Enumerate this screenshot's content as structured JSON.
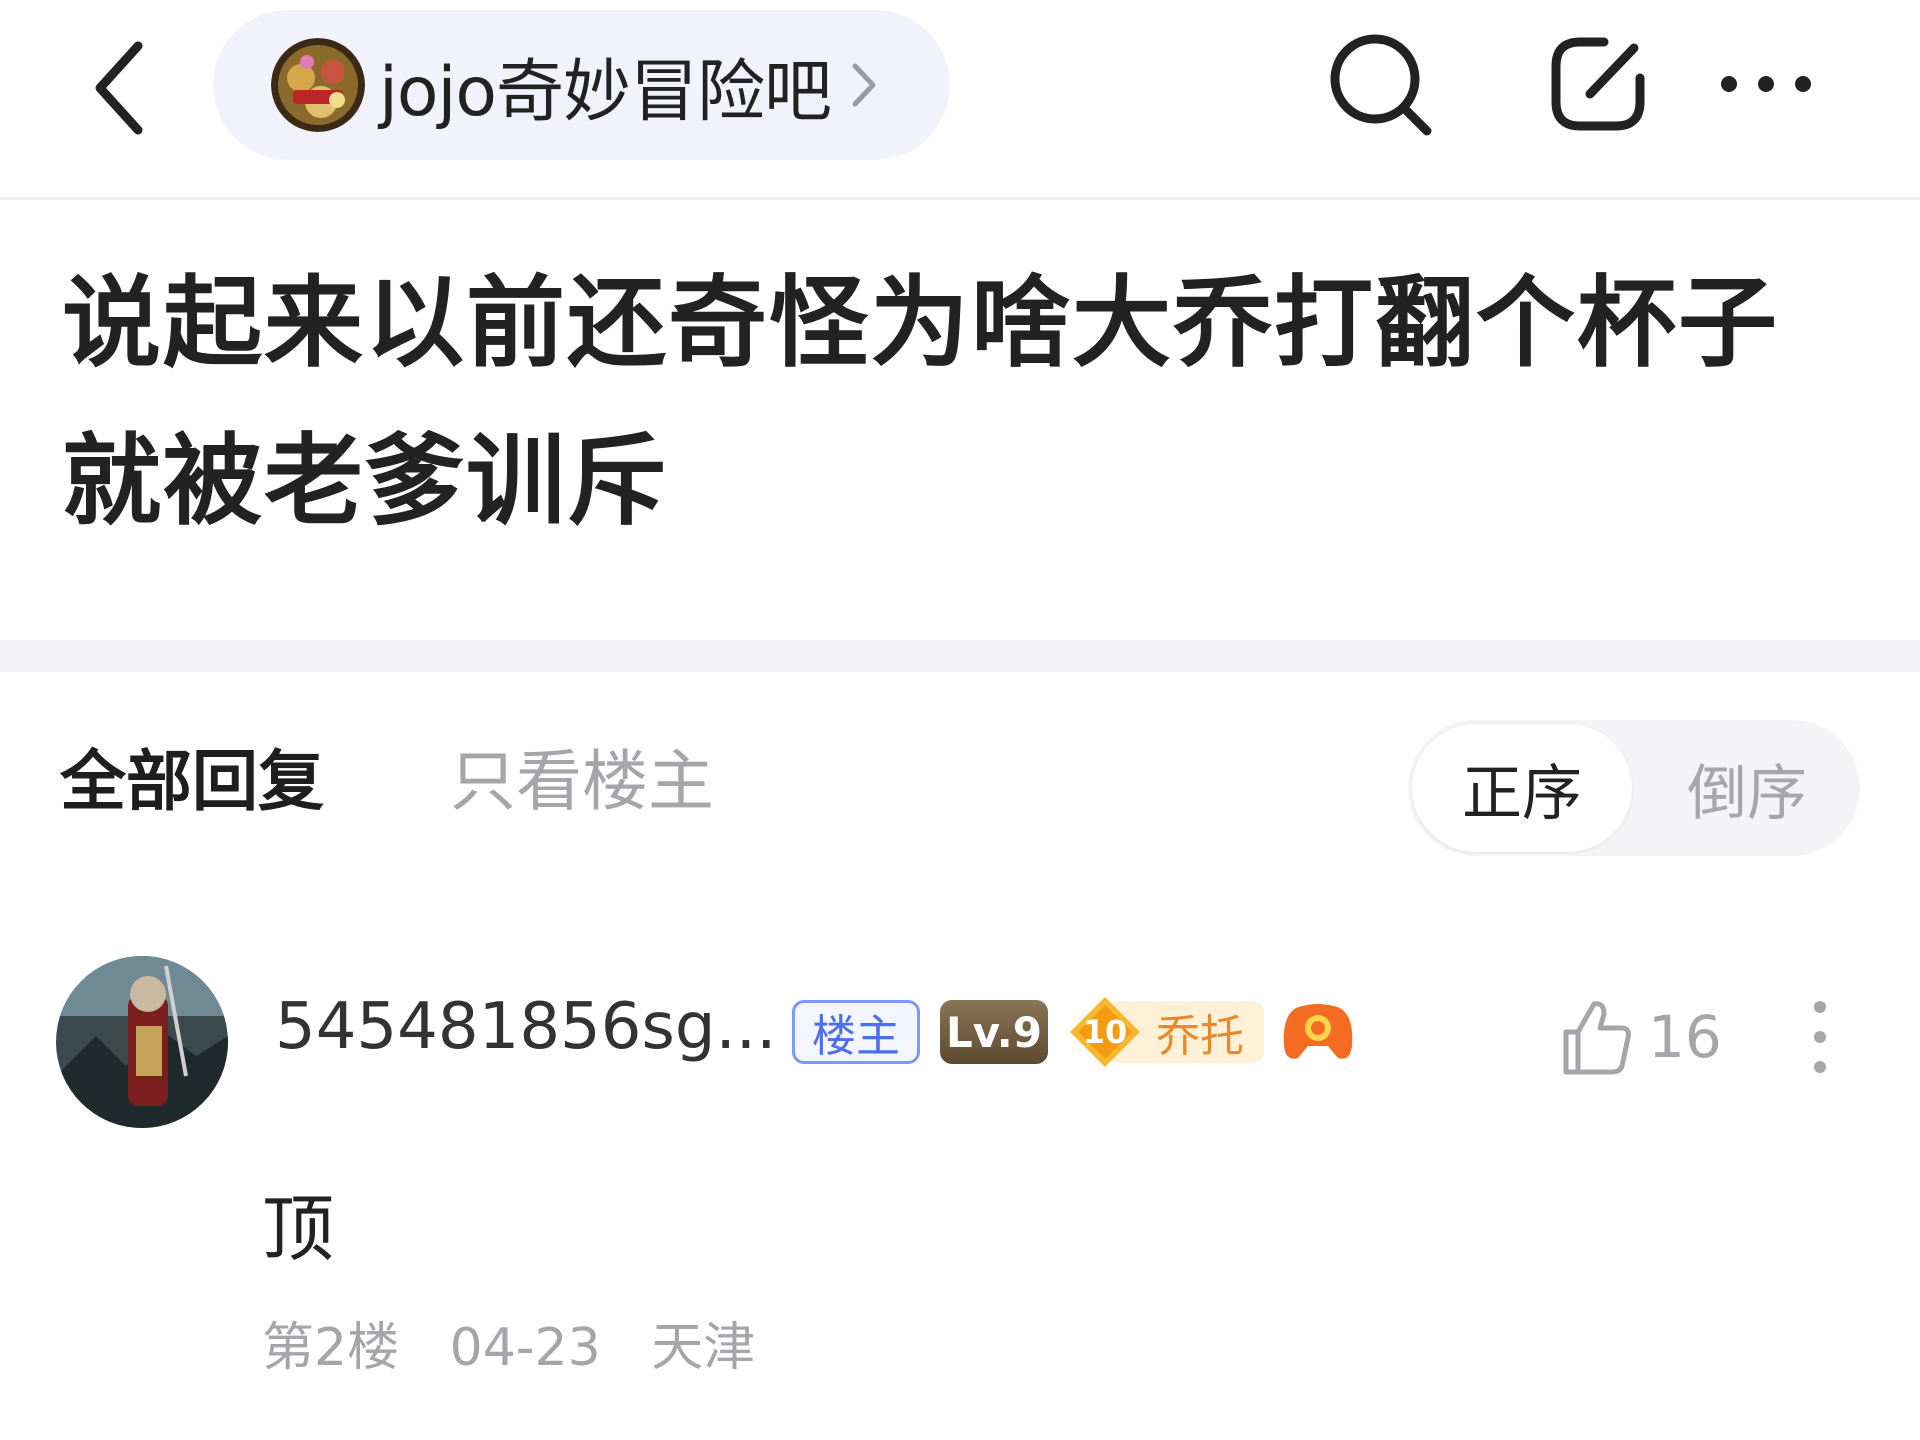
{
  "header": {
    "forum_name": "jojo奇妙冒险吧",
    "icons": {
      "back": "back-chevron-icon",
      "forum_chevron": "chevron-right-icon",
      "search": "search-icon",
      "share": "share-icon",
      "more": "more-horizontal-icon"
    }
  },
  "post": {
    "title": "说起来以前还奇怪为啥大乔打翻个杯子就被老爹训斥"
  },
  "reply_filter": {
    "tab_all": "全部回复",
    "tab_op_only": "只看楼主",
    "sort_asc": "正序",
    "sort_desc": "倒序",
    "active_sort": "正序"
  },
  "reply": {
    "username": "545481856sg...",
    "badge_op": "楼主",
    "level": "Lv.9",
    "title_badge_num": "10",
    "title_badge_text": "乔托",
    "like_count": "16",
    "content": "顶",
    "floor": "第2楼",
    "date": "04-23",
    "location": "天津"
  },
  "colors": {
    "accent_blue": "#4b6df0",
    "badge_orange": "#e88a2a",
    "muted_gray": "#a6a6aa",
    "pill_bg": "#f1f2fb"
  }
}
